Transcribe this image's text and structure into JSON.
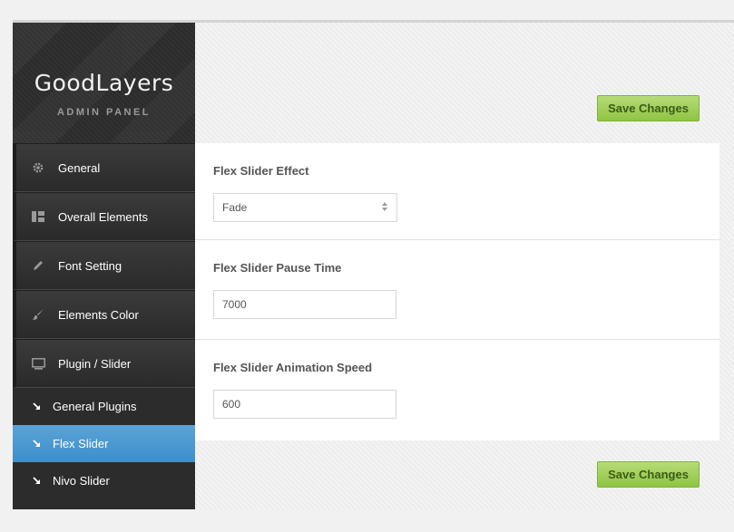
{
  "logo": {
    "title": "GoodLayers",
    "subtitle": "ADMIN PANEL"
  },
  "sidebar": {
    "items": [
      {
        "label": "General",
        "icon": "gear-icon"
      },
      {
        "label": "Overall Elements",
        "icon": "layout-icon"
      },
      {
        "label": "Font Setting",
        "icon": "pencil-icon"
      },
      {
        "label": "Elements Color",
        "icon": "brush-icon"
      },
      {
        "label": "Plugin / Slider",
        "icon": "slider-icon"
      }
    ],
    "subitems": [
      {
        "label": "General Plugins",
        "active": false
      },
      {
        "label": "Flex Slider",
        "active": true
      },
      {
        "label": "Nivo Slider",
        "active": false
      }
    ]
  },
  "toolbar": {
    "save_label": "Save Changes"
  },
  "settings": {
    "effect": {
      "label": "Flex Slider Effect",
      "value": "Fade"
    },
    "pause": {
      "label": "Flex Slider Pause Time",
      "value": "7000"
    },
    "speed": {
      "label": "Flex Slider Animation Speed",
      "value": "600"
    }
  },
  "colors": {
    "accent": "#4a97d0",
    "save_button": "#a6d25e",
    "sidebar_bg": "#2c2c2c"
  }
}
